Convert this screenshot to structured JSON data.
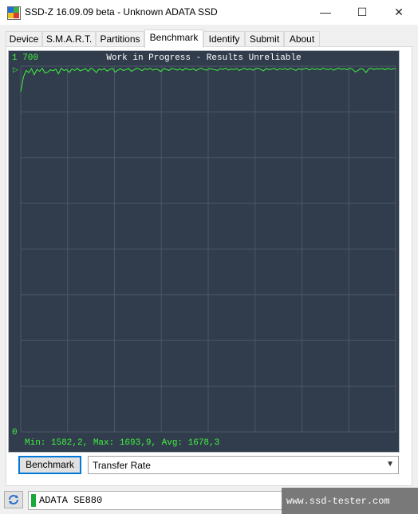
{
  "window": {
    "title": "SSD-Z 16.09.09 beta - Unknown ADATA SSD",
    "minimize": "—",
    "maximize": "☐",
    "close": "✕"
  },
  "tabs": [
    {
      "label": "Device"
    },
    {
      "label": "S.M.A.R.T."
    },
    {
      "label": "Partitions"
    },
    {
      "label": "Benchmark",
      "active": true
    },
    {
      "label": "Identify"
    },
    {
      "label": "Submit"
    },
    {
      "label": "About"
    }
  ],
  "graph": {
    "status": "Work in Progress - Results Unreliable",
    "y_max_label": "1 700",
    "y_min_label": "0",
    "marker": "▷",
    "stats": "Min: 1582,2, Max: 1693,9, Avg: 1678,3",
    "colors": {
      "background": "#313d4c",
      "grid": "#4a5767",
      "line": "#3ef33e"
    }
  },
  "controls": {
    "benchmark_button": "Benchmark",
    "mode_selected": "Transfer Rate"
  },
  "drive": {
    "name": "ADATA SE880"
  },
  "watermark": "www.ssd-tester.com",
  "chart_data": {
    "type": "line",
    "title": "Work in Progress - Results Unreliable",
    "ylim": [
      0,
      1700
    ],
    "y_ticks": [
      "0",
      "1 700"
    ],
    "grid": true,
    "summary": {
      "min": 1582.2,
      "max": 1693.9,
      "avg": 1678.3
    },
    "values": [
      1582,
      1650,
      1680,
      1670,
      1688,
      1660,
      1685,
      1676,
      1690,
      1668,
      1672,
      1683,
      1679,
      1686,
      1664,
      1690,
      1680,
      1684,
      1671,
      1687,
      1680,
      1690,
      1678,
      1683,
      1688,
      1676,
      1690,
      1684,
      1670,
      1687,
      1682,
      1689,
      1677,
      1685,
      1690,
      1672,
      1681,
      1688,
      1680,
      1684,
      1689,
      1676,
      1683,
      1690,
      1686,
      1679,
      1688,
      1684,
      1690,
      1681,
      1687,
      1683,
      1675,
      1689,
      1685,
      1680,
      1690,
      1686,
      1682,
      1688,
      1680,
      1690,
      1685,
      1683,
      1688,
      1679,
      1687,
      1690,
      1684,
      1681,
      1689,
      1686,
      1683,
      1680,
      1688,
      1685,
      1690,
      1682,
      1687,
      1684,
      1689,
      1680,
      1686,
      1690,
      1683,
      1688,
      1681,
      1687,
      1690,
      1685,
      1678,
      1689,
      1684,
      1686,
      1690,
      1682,
      1688,
      1685,
      1689,
      1683,
      1690,
      1686,
      1680,
      1688,
      1684,
      1687,
      1690,
      1682,
      1689,
      1685,
      1688,
      1683,
      1690,
      1686,
      1684,
      1689,
      1681,
      1687,
      1690,
      1685,
      1688,
      1683,
      1690,
      1686,
      1673,
      1680,
      1689,
      1685,
      1670,
      1687,
      1690,
      1684,
      1688,
      1686,
      1689,
      1683,
      1690,
      1685,
      1687,
      1688
    ]
  }
}
